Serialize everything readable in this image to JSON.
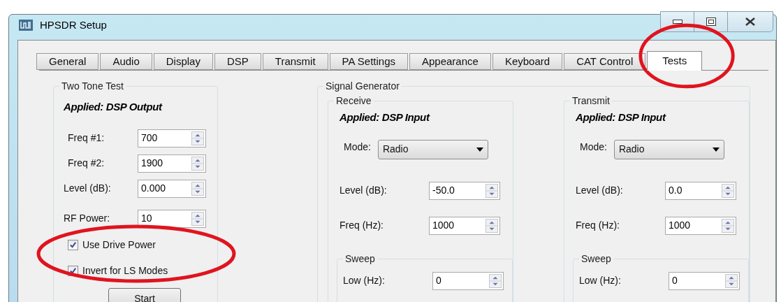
{
  "window": {
    "title": "HPSDR Setup"
  },
  "tabs": [
    {
      "label": "General",
      "selected": false
    },
    {
      "label": "Audio",
      "selected": false
    },
    {
      "label": "Display",
      "selected": false
    },
    {
      "label": "DSP",
      "selected": false
    },
    {
      "label": "Transmit",
      "selected": false
    },
    {
      "label": "PA Settings",
      "selected": false
    },
    {
      "label": "Appearance",
      "selected": false
    },
    {
      "label": "Keyboard",
      "selected": false
    },
    {
      "label": "CAT Control",
      "selected": false
    },
    {
      "label": "Tests",
      "selected": true
    }
  ],
  "two_tone_test": {
    "title": "Two Tone Test",
    "applied": "Applied: DSP Output",
    "fields": [
      {
        "label": "Freq #1:",
        "value": "700"
      },
      {
        "label": "Freq #2:",
        "value": "1900"
      },
      {
        "label": "Level (dB):",
        "value": "0.000"
      },
      {
        "label": "RF Power:",
        "value": "10"
      }
    ],
    "checkboxes": [
      {
        "label": "Use Drive Power",
        "checked": true
      },
      {
        "label": "Invert for LS Modes",
        "checked": true
      }
    ],
    "button": "Start"
  },
  "signal_generator": {
    "title": "Signal Generator",
    "sections": [
      {
        "title": "Receive",
        "applied": "Applied: DSP Input",
        "mode_label": "Mode:",
        "mode_value": "Radio",
        "fields": [
          {
            "label": "Level (dB):",
            "value": "-50.0"
          },
          {
            "label": "Freq (Hz):",
            "value": "1000"
          }
        ],
        "sweep": {
          "title": "Sweep",
          "fields": [
            {
              "label": "Low (Hz):",
              "value": "0"
            }
          ]
        }
      },
      {
        "title": "Transmit",
        "applied": "Applied: DSP Input",
        "mode_label": "Mode:",
        "mode_value": "Radio",
        "fields": [
          {
            "label": "Level (dB):",
            "value": "0.0"
          },
          {
            "label": "Freq (Hz):",
            "value": "1000"
          }
        ],
        "sweep": {
          "title": "Sweep",
          "fields": [
            {
              "label": "Low (Hz):",
              "value": "0"
            }
          ]
        }
      }
    ]
  }
}
